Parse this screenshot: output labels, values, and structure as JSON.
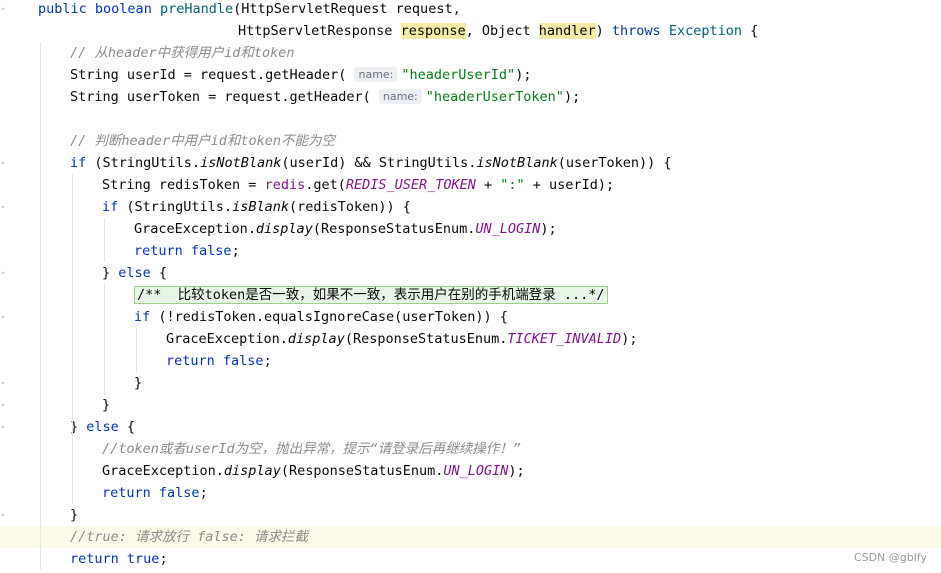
{
  "editor": {
    "lines": [
      {
        "indent": 38,
        "segments": [
          {
            "t": "public",
            "c": "kw"
          },
          {
            "t": " "
          },
          {
            "t": "boolean",
            "c": "kw"
          },
          {
            "t": " "
          },
          {
            "t": "preHandle",
            "c": "fn"
          },
          {
            "t": "(HttpServletRequest request,"
          }
        ]
      },
      {
        "indent": 238,
        "segments": [
          {
            "t": "HttpServletResponse "
          },
          {
            "t": "response",
            "c": "param-hl"
          },
          {
            "t": ", Object "
          },
          {
            "t": "handler",
            "c": "param-hl"
          },
          {
            "t": ") "
          },
          {
            "t": "throws",
            "c": "kw"
          },
          {
            "t": " "
          },
          {
            "t": "Exception",
            "c": "fn"
          },
          {
            "t": " {"
          }
        ]
      },
      {
        "indent": 70,
        "segments": [
          {
            "t": "// 从header中获得用户id和token",
            "c": "cmt"
          }
        ]
      },
      {
        "indent": 70,
        "segments": [
          {
            "t": "String userId = request.getHeader( "
          },
          {
            "t": "name:",
            "c": "hint"
          },
          {
            "t": "\"headerUserId\"",
            "c": "str"
          },
          {
            "t": ");"
          }
        ]
      },
      {
        "indent": 70,
        "segments": [
          {
            "t": "String userToken = request.getHeader( "
          },
          {
            "t": "name:",
            "c": "hint"
          },
          {
            "t": "\"headerUserToken\"",
            "c": "str"
          },
          {
            "t": ");"
          }
        ]
      },
      {
        "indent": 70,
        "segments": []
      },
      {
        "indent": 70,
        "segments": [
          {
            "t": "// 判断header中用户id和token不能为空",
            "c": "cmt"
          }
        ]
      },
      {
        "indent": 70,
        "segments": [
          {
            "t": "if",
            "c": "kw"
          },
          {
            "t": " (StringUtils."
          },
          {
            "t": "isNotBlank",
            "c": "static"
          },
          {
            "t": "(userId) && StringUtils."
          },
          {
            "t": "isNotBlank",
            "c": "static"
          },
          {
            "t": "(userToken)) {"
          }
        ]
      },
      {
        "indent": 102,
        "segments": [
          {
            "t": "String redisToken = "
          },
          {
            "t": "redis",
            "c": "field"
          },
          {
            "t": ".get("
          },
          {
            "t": "REDIS_USER_TOKEN",
            "c": "const"
          },
          {
            "t": " + "
          },
          {
            "t": "\":\"",
            "c": "str"
          },
          {
            "t": " + userId);"
          }
        ]
      },
      {
        "indent": 102,
        "segments": [
          {
            "t": "if",
            "c": "kw"
          },
          {
            "t": " (StringUtils."
          },
          {
            "t": "isBlank",
            "c": "static"
          },
          {
            "t": "(redisToken)) {"
          }
        ]
      },
      {
        "indent": 134,
        "segments": [
          {
            "t": "GraceException."
          },
          {
            "t": "display",
            "c": "static"
          },
          {
            "t": "(ResponseStatusEnum."
          },
          {
            "t": "UN_LOGIN",
            "c": "const"
          },
          {
            "t": ");"
          }
        ]
      },
      {
        "indent": 134,
        "segments": [
          {
            "t": "return",
            "c": "kw"
          },
          {
            "t": " "
          },
          {
            "t": "false",
            "c": "kw"
          },
          {
            "t": ";"
          }
        ]
      },
      {
        "indent": 102,
        "segments": [
          {
            "t": "} "
          },
          {
            "t": "else",
            "c": "kw"
          },
          {
            "t": " {"
          }
        ]
      },
      {
        "indent": 134,
        "segments": [
          {
            "t": "/**  比较token是否一致，如果不一致，表示用户在别的手机端登录 ...*/",
            "c": "folded"
          }
        ]
      },
      {
        "indent": 134,
        "segments": [
          {
            "t": "if",
            "c": "kw"
          },
          {
            "t": " (!redisToken.equalsIgnoreCase(userToken)) {"
          }
        ]
      },
      {
        "indent": 166,
        "segments": [
          {
            "t": "GraceException."
          },
          {
            "t": "display",
            "c": "static"
          },
          {
            "t": "(ResponseStatusEnum."
          },
          {
            "t": "TICKET_INVALID",
            "c": "const"
          },
          {
            "t": ");"
          }
        ]
      },
      {
        "indent": 166,
        "segments": [
          {
            "t": "return",
            "c": "kw"
          },
          {
            "t": " "
          },
          {
            "t": "false",
            "c": "kw"
          },
          {
            "t": ";"
          }
        ]
      },
      {
        "indent": 134,
        "segments": [
          {
            "t": "}"
          }
        ]
      },
      {
        "indent": 102,
        "segments": [
          {
            "t": "}"
          }
        ]
      },
      {
        "indent": 70,
        "segments": [
          {
            "t": "} "
          },
          {
            "t": "else",
            "c": "kw"
          },
          {
            "t": " {"
          }
        ]
      },
      {
        "indent": 102,
        "segments": [
          {
            "t": "//token或者userId为空，抛出异常，提示“请登录后再继续操作！”",
            "c": "cmt"
          }
        ]
      },
      {
        "indent": 102,
        "segments": [
          {
            "t": "GraceException."
          },
          {
            "t": "display",
            "c": "static"
          },
          {
            "t": "(ResponseStatusEnum."
          },
          {
            "t": "UN_LOGIN",
            "c": "const"
          },
          {
            "t": ");"
          }
        ]
      },
      {
        "indent": 102,
        "segments": [
          {
            "t": "return",
            "c": "kw"
          },
          {
            "t": " "
          },
          {
            "t": "false",
            "c": "kw"
          },
          {
            "t": ";"
          }
        ]
      },
      {
        "indent": 70,
        "segments": [
          {
            "t": "}"
          }
        ]
      },
      {
        "indent": 70,
        "highlight": true,
        "segments": [
          {
            "t": "//true: 请求放行 false: 请求拦截",
            "c": "cmt"
          }
        ]
      },
      {
        "indent": 70,
        "segments": [
          {
            "t": "return",
            "c": "kw"
          },
          {
            "t": " "
          },
          {
            "t": "true",
            "c": "kw"
          },
          {
            "t": ";"
          }
        ]
      }
    ]
  },
  "watermark": "CSDN @gblfy",
  "colors": {
    "keyword": "#0033b3",
    "string": "#067d17",
    "comment": "#8c8c8c",
    "constant": "#871094",
    "method": "#00627a",
    "highlight": "#fcfae8"
  }
}
